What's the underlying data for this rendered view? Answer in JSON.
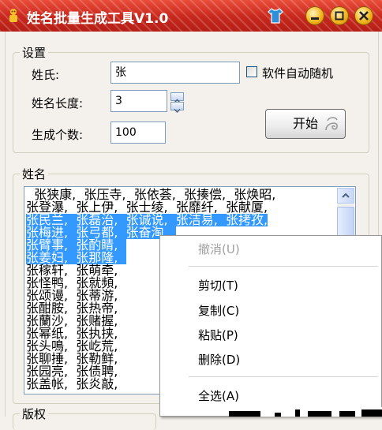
{
  "window": {
    "title": "姓名批量生成工具V1.0",
    "accent_color": "#c7271c"
  },
  "settings": {
    "legend": "设置",
    "surname_label": "姓氏:",
    "surname_value": "张",
    "random_software_label": "软件自动随机",
    "length_label": "姓名长度:",
    "length_value": "3",
    "count_label": "生成个数:",
    "count_value": "100",
    "start_button": "开始"
  },
  "names": {
    "legend": "姓名",
    "lines": [
      "  张狭康,  张压寺,  张依荟,  张揍偿,  张焕昭,",
      "张登瀑,  张上伊,  张士绫,  张靡纤,  张献厦,",
      "张民兰,  张磊治,  张诚说,  张洁易,  张拷孜,",
      "张梅进,  张弓都,  张奋淘,  ",
      "张臂事,  张酌睛,  ",
      "张姜妇,  张那隆,  ",
      "张稼轩,  张萌牵,  ",
      "张怪鸭,  张就頻,  ",
      "张颂谩,  张蒂游,  ",
      "张酣胺,  张热帝,  ",
      "张蘭沙,  张赌握,  ",
      "张幂纸,  张执挟,  ",
      "张头鳴,  张屹荒,  ",
      "张聊捶,  张勒鲜,  ",
      "张园亮,  张债聘,  ",
      "张盖帐,  张炎敲,  "
    ],
    "selected_lines": [
      2,
      3,
      4,
      5
    ]
  },
  "copyright": {
    "legend": "版权"
  },
  "context_menu": {
    "undo": "撤消(U)",
    "cut": "剪切(T)",
    "copy": "复制(C)",
    "paste": "粘贴(P)",
    "delete": "删除(D)",
    "select_all": "全选(A)"
  }
}
